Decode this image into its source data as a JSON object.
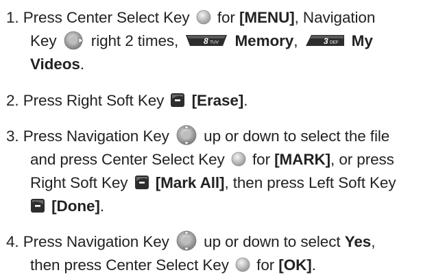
{
  "steps": [
    {
      "number": "1.",
      "line1": {
        "a": "Press Center Select Key",
        "icon": "center-select-key-icon",
        "b": "for",
        "bold": "[MENU]",
        "c": ", Navigation"
      },
      "line2": {
        "a": "Key",
        "icon": "navigation-right-key-icon",
        "b": "right 2 times,",
        "key1": "8tuv-key-icon",
        "bold1": "Memory",
        "sep": ",",
        "key2": "3def-key-icon",
        "bold2": "My"
      },
      "line3": {
        "bold": "Videos",
        "c": "."
      }
    },
    {
      "number": "2.",
      "line1": {
        "a": "Press Right Soft Key",
        "icon": "right-soft-key-icon",
        "bold": "[Erase]",
        "c": "."
      }
    },
    {
      "number": "3.",
      "line1": {
        "a": "Press Navigation Key",
        "icon": "navigation-key-icon",
        "b": "up or down to select the file"
      },
      "line2": {
        "a": "and press Center Select Key",
        "icon": "center-select-key-icon",
        "b": "for",
        "bold": "[MARK]",
        "c": ", or press"
      },
      "line3": {
        "a": "Right Soft Key",
        "icon": "right-soft-key-icon",
        "bold": "[Mark All]",
        "b": ", then press Left Soft Key"
      },
      "line4": {
        "icon": "left-soft-key-icon",
        "bold": "[Done]",
        "c": "."
      }
    },
    {
      "number": "4.",
      "line1": {
        "a": "Press Navigation Key",
        "icon": "navigation-key-icon",
        "b": "up or down to select",
        "bold": "Yes",
        "c": ","
      },
      "line2": {
        "a": "then press Center Select Key",
        "icon": "center-select-key-icon",
        "b": "for",
        "bold": "[OK]",
        "c": "."
      }
    }
  ],
  "key_labels": {
    "key8": "8",
    "key8_letters": "TUV",
    "key3": "3",
    "key3_letters": "DEF"
  },
  "colors": {
    "text": "#222222",
    "key_dark": "#3a3a3a",
    "key_light": "#d9d9d9",
    "key_green": "#6b7f2a"
  }
}
